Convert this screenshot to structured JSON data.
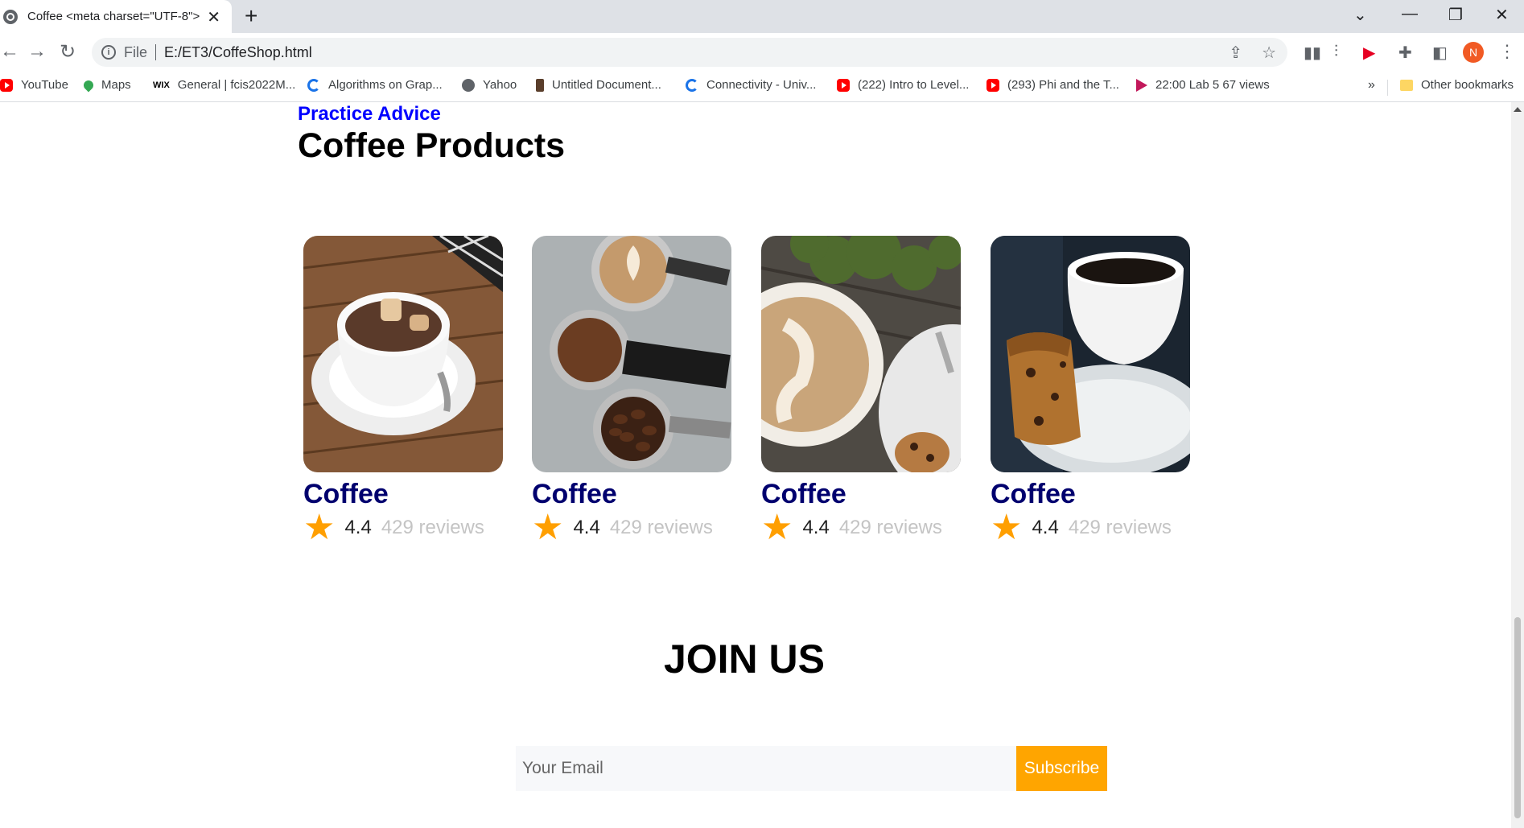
{
  "browser": {
    "tab_title": "Coffee <meta charset=\"UTF-8\">",
    "new_tab_icon": "+",
    "url_scheme": "File",
    "url": "E:/ET3/CoffeShop.html",
    "profile_initial": "N",
    "bookmarks": [
      {
        "label": "YouTube",
        "icon": "youtube-icon"
      },
      {
        "label": "Maps",
        "icon": "maps-icon"
      },
      {
        "label": "General | fcis2022M...",
        "icon": "wix-icon"
      },
      {
        "label": "Algorithms on Grap...",
        "icon": "coursera-icon"
      },
      {
        "label": "Yahoo",
        "icon": "globe-icon"
      },
      {
        "label": "Untitled Document...",
        "icon": "document-icon"
      },
      {
        "label": "Connectivity - Univ...",
        "icon": "coursera-icon"
      },
      {
        "label": "(222) Intro to Level...",
        "icon": "youtube-icon"
      },
      {
        "label": "(293) Phi and the T...",
        "icon": "youtube-icon"
      },
      {
        "label": "22:00 Lab 5 67 views",
        "icon": "play-icon"
      }
    ],
    "more_bookmarks": "»",
    "other_bookmarks": "Other bookmarks"
  },
  "page": {
    "kicker": "Practice Advice",
    "title": "Coffee Products",
    "products": [
      {
        "name": "Coffee",
        "score": "4.4",
        "reviews": "429 reviews",
        "image": "coffee-cup-with-marshmallows"
      },
      {
        "name": "Coffee",
        "score": "4.4",
        "reviews": "429 reviews",
        "image": "latte-and-portafilters"
      },
      {
        "name": "Coffee",
        "score": "4.4",
        "reviews": "429 reviews",
        "image": "latte-with-cookie"
      },
      {
        "name": "Coffee",
        "score": "4.4",
        "reviews": "429 reviews",
        "image": "coffee-with-cake"
      }
    ],
    "join_title": "JOIN US",
    "email_placeholder": "Your Email",
    "subscribe_label": "Subscribe"
  },
  "colors": {
    "kicker": "#0000ff",
    "product_name": "#00006e",
    "star": "#ff9f00",
    "subscribe_bg": "#ffa500"
  }
}
